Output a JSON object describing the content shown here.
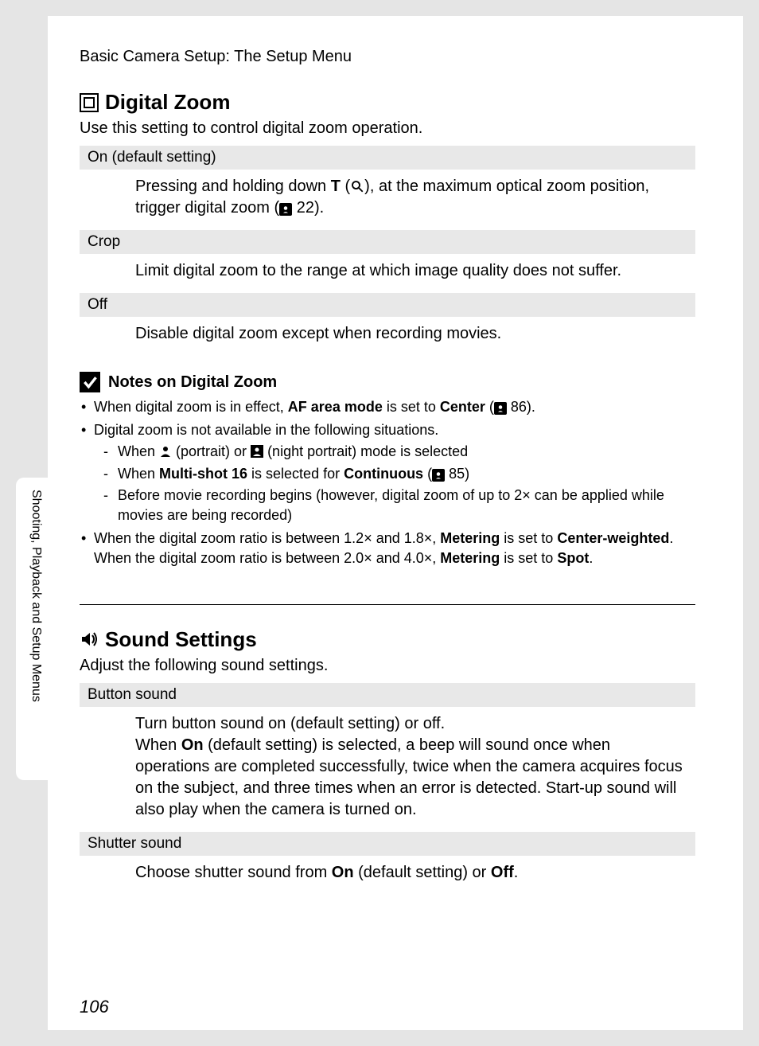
{
  "breadcrumb": "Basic Camera Setup: The Setup Menu",
  "side_label": "Shooting, Playback and Setup Menus",
  "page_number": "106",
  "digital_zoom": {
    "title": "Digital Zoom",
    "intro": "Use this setting to control digital zoom operation.",
    "options": [
      {
        "label": "On (default setting)",
        "body_before": "Pressing and holding down ",
        "body_bold1": "T",
        "body_mid1": " (",
        "body_mid2": "), at the maximum optical zoom position, trigger digital zoom (",
        "body_ref": " 22).",
        "ref_icon": true
      },
      {
        "label": "Crop",
        "body": "Limit digital zoom to the range at which image quality does not suffer."
      },
      {
        "label": "Off",
        "body": "Disable digital zoom except when recording movies."
      }
    ],
    "notes_title": "Notes on Digital Zoom",
    "notes": {
      "n1_a": "When digital zoom is in effect, ",
      "n1_b": "AF area mode",
      "n1_c": " is set to ",
      "n1_d": "Center",
      "n1_e": " (",
      "n1_f": " 86).",
      "n2": "Digital zoom is not available in the following situations.",
      "n2_sub1_a": "When ",
      "n2_sub1_b": " (portrait) or ",
      "n2_sub1_c": " (night portrait) mode is selected",
      "n2_sub2_a": "When ",
      "n2_sub2_b": "Multi-shot 16",
      "n2_sub2_c": " is selected for ",
      "n2_sub2_d": "Continuous",
      "n2_sub2_e": " (",
      "n2_sub2_f": " 85)",
      "n2_sub3": "Before movie recording begins (however, digital zoom of up to 2× can be applied while movies are being recorded)",
      "n3_a": "When the digital zoom ratio is between 1.2× and 1.8×, ",
      "n3_b": "Metering",
      "n3_c": " is set to ",
      "n3_d": "Center-weighted",
      "n3_e": ". When the digital zoom ratio is between 2.0× and 4.0×, ",
      "n3_f": "Metering",
      "n3_g": " is set to ",
      "n3_h": "Spot",
      "n3_i": "."
    }
  },
  "sound_settings": {
    "title": "Sound Settings",
    "intro": "Adjust the following sound settings.",
    "options": [
      {
        "label": "Button sound",
        "body_a": "Turn button sound on (default setting) or off.",
        "body_b1": "When ",
        "body_b2": "On",
        "body_b3": " (default setting) is selected, a beep will sound once when operations are completed successfully, twice when the camera acquires focus on the subject, and three times when an error is detected. Start-up sound will also play when the camera is turned on."
      },
      {
        "label": "Shutter sound",
        "body_a": "Choose shutter sound from ",
        "body_b": "On",
        "body_c": " (default setting) or ",
        "body_d": "Off",
        "body_e": "."
      }
    ]
  }
}
